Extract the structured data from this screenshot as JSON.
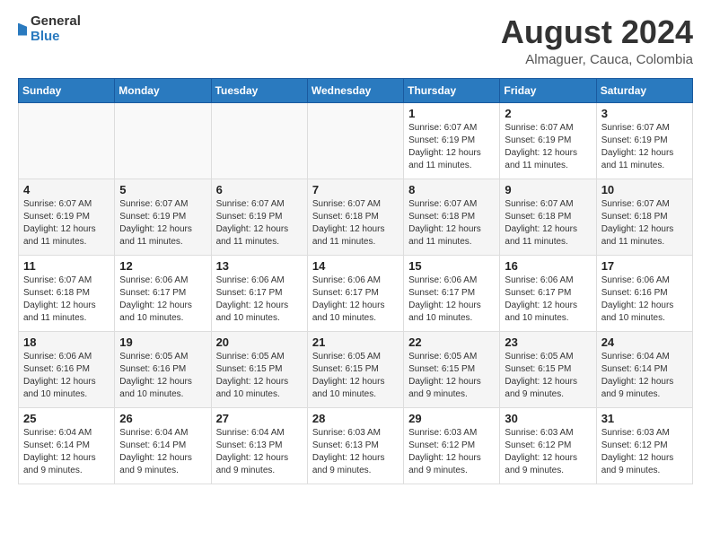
{
  "header": {
    "logo_general": "General",
    "logo_blue": "Blue",
    "month_year": "August 2024",
    "location": "Almaguer, Cauca, Colombia"
  },
  "days_of_week": [
    "Sunday",
    "Monday",
    "Tuesday",
    "Wednesday",
    "Thursday",
    "Friday",
    "Saturday"
  ],
  "weeks": [
    [
      {
        "day": "",
        "info": ""
      },
      {
        "day": "",
        "info": ""
      },
      {
        "day": "",
        "info": ""
      },
      {
        "day": "",
        "info": ""
      },
      {
        "day": "1",
        "info": "Sunrise: 6:07 AM\nSunset: 6:19 PM\nDaylight: 12 hours\nand 11 minutes."
      },
      {
        "day": "2",
        "info": "Sunrise: 6:07 AM\nSunset: 6:19 PM\nDaylight: 12 hours\nand 11 minutes."
      },
      {
        "day": "3",
        "info": "Sunrise: 6:07 AM\nSunset: 6:19 PM\nDaylight: 12 hours\nand 11 minutes."
      }
    ],
    [
      {
        "day": "4",
        "info": "Sunrise: 6:07 AM\nSunset: 6:19 PM\nDaylight: 12 hours\nand 11 minutes."
      },
      {
        "day": "5",
        "info": "Sunrise: 6:07 AM\nSunset: 6:19 PM\nDaylight: 12 hours\nand 11 minutes."
      },
      {
        "day": "6",
        "info": "Sunrise: 6:07 AM\nSunset: 6:19 PM\nDaylight: 12 hours\nand 11 minutes."
      },
      {
        "day": "7",
        "info": "Sunrise: 6:07 AM\nSunset: 6:18 PM\nDaylight: 12 hours\nand 11 minutes."
      },
      {
        "day": "8",
        "info": "Sunrise: 6:07 AM\nSunset: 6:18 PM\nDaylight: 12 hours\nand 11 minutes."
      },
      {
        "day": "9",
        "info": "Sunrise: 6:07 AM\nSunset: 6:18 PM\nDaylight: 12 hours\nand 11 minutes."
      },
      {
        "day": "10",
        "info": "Sunrise: 6:07 AM\nSunset: 6:18 PM\nDaylight: 12 hours\nand 11 minutes."
      }
    ],
    [
      {
        "day": "11",
        "info": "Sunrise: 6:07 AM\nSunset: 6:18 PM\nDaylight: 12 hours\nand 11 minutes."
      },
      {
        "day": "12",
        "info": "Sunrise: 6:06 AM\nSunset: 6:17 PM\nDaylight: 12 hours\nand 10 minutes."
      },
      {
        "day": "13",
        "info": "Sunrise: 6:06 AM\nSunset: 6:17 PM\nDaylight: 12 hours\nand 10 minutes."
      },
      {
        "day": "14",
        "info": "Sunrise: 6:06 AM\nSunset: 6:17 PM\nDaylight: 12 hours\nand 10 minutes."
      },
      {
        "day": "15",
        "info": "Sunrise: 6:06 AM\nSunset: 6:17 PM\nDaylight: 12 hours\nand 10 minutes."
      },
      {
        "day": "16",
        "info": "Sunrise: 6:06 AM\nSunset: 6:17 PM\nDaylight: 12 hours\nand 10 minutes."
      },
      {
        "day": "17",
        "info": "Sunrise: 6:06 AM\nSunset: 6:16 PM\nDaylight: 12 hours\nand 10 minutes."
      }
    ],
    [
      {
        "day": "18",
        "info": "Sunrise: 6:06 AM\nSunset: 6:16 PM\nDaylight: 12 hours\nand 10 minutes."
      },
      {
        "day": "19",
        "info": "Sunrise: 6:05 AM\nSunset: 6:16 PM\nDaylight: 12 hours\nand 10 minutes."
      },
      {
        "day": "20",
        "info": "Sunrise: 6:05 AM\nSunset: 6:15 PM\nDaylight: 12 hours\nand 10 minutes."
      },
      {
        "day": "21",
        "info": "Sunrise: 6:05 AM\nSunset: 6:15 PM\nDaylight: 12 hours\nand 10 minutes."
      },
      {
        "day": "22",
        "info": "Sunrise: 6:05 AM\nSunset: 6:15 PM\nDaylight: 12 hours\nand 9 minutes."
      },
      {
        "day": "23",
        "info": "Sunrise: 6:05 AM\nSunset: 6:15 PM\nDaylight: 12 hours\nand 9 minutes."
      },
      {
        "day": "24",
        "info": "Sunrise: 6:04 AM\nSunset: 6:14 PM\nDaylight: 12 hours\nand 9 minutes."
      }
    ],
    [
      {
        "day": "25",
        "info": "Sunrise: 6:04 AM\nSunset: 6:14 PM\nDaylight: 12 hours\nand 9 minutes."
      },
      {
        "day": "26",
        "info": "Sunrise: 6:04 AM\nSunset: 6:14 PM\nDaylight: 12 hours\nand 9 minutes."
      },
      {
        "day": "27",
        "info": "Sunrise: 6:04 AM\nSunset: 6:13 PM\nDaylight: 12 hours\nand 9 minutes."
      },
      {
        "day": "28",
        "info": "Sunrise: 6:03 AM\nSunset: 6:13 PM\nDaylight: 12 hours\nand 9 minutes."
      },
      {
        "day": "29",
        "info": "Sunrise: 6:03 AM\nSunset: 6:12 PM\nDaylight: 12 hours\nand 9 minutes."
      },
      {
        "day": "30",
        "info": "Sunrise: 6:03 AM\nSunset: 6:12 PM\nDaylight: 12 hours\nand 9 minutes."
      },
      {
        "day": "31",
        "info": "Sunrise: 6:03 AM\nSunset: 6:12 PM\nDaylight: 12 hours\nand 9 minutes."
      }
    ]
  ]
}
